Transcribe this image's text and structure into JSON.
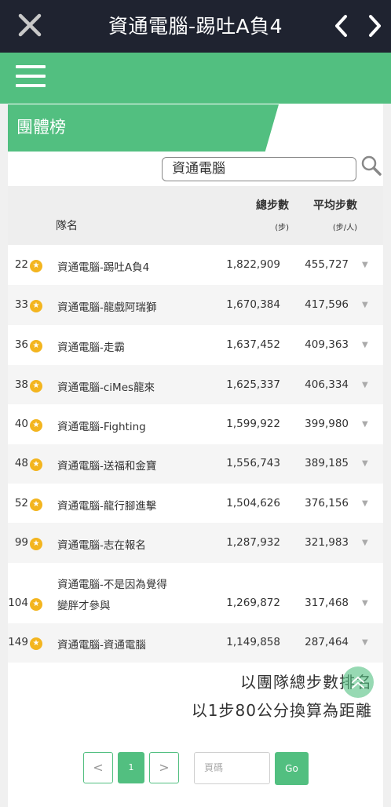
{
  "header": {
    "title": "資通電腦-踢吐A負4",
    "close_icon": "close-icon",
    "prev_icon": "chevron-left-icon",
    "next_icon": "chevron-right-icon"
  },
  "menu": {
    "icon": "hamburger-menu-icon"
  },
  "section": {
    "title": "團體榜"
  },
  "search": {
    "value": "資通電腦",
    "icon": "search-icon"
  },
  "table": {
    "headers": {
      "team": "隊名",
      "total": "總步數",
      "total_unit": "(步)",
      "avg": "平均步數",
      "avg_unit": "(步/人)"
    },
    "rows": [
      {
        "rank": "22",
        "name": "資通電腦-踢吐A負4",
        "total": "1,822,909",
        "avg": "455,727"
      },
      {
        "rank": "33",
        "name": "資通電腦-龍戲阿瑞獅",
        "total": "1,670,384",
        "avg": "417,596"
      },
      {
        "rank": "36",
        "name": "資通電腦-走霸",
        "total": "1,637,452",
        "avg": "409,363"
      },
      {
        "rank": "38",
        "name": "資通電腦-ciMes龍來",
        "total": "1,625,337",
        "avg": "406,334"
      },
      {
        "rank": "40",
        "name": "資通電腦-Fighting",
        "total": "1,599,922",
        "avg": "399,980"
      },
      {
        "rank": "48",
        "name": "資通電腦-送福和金寶",
        "total": "1,556,743",
        "avg": "389,185"
      },
      {
        "rank": "52",
        "name": "資通電腦-龍行腳進擊",
        "total": "1,504,626",
        "avg": "376,156"
      },
      {
        "rank": "99",
        "name": "資通電腦-志在報名",
        "total": "1,287,932",
        "avg": "321,983"
      },
      {
        "rank": "104",
        "name_line1": "資通電腦-不是因為覺得",
        "name_line2": "變胖才參與",
        "total": "1,269,872",
        "avg": "317,468"
      },
      {
        "rank": "149",
        "name": "資通電腦-資通電腦",
        "total": "1,149,858",
        "avg": "287,464"
      }
    ]
  },
  "notes": {
    "line1": "以團隊總步數排名",
    "line2": "以1步80公分換算為距離"
  },
  "pager": {
    "prev": "<",
    "current": "1",
    "next": ">",
    "input_placeholder": "頁碼",
    "go": "Go"
  },
  "colors": {
    "topbar": "#1f2330",
    "accent": "#52bf80",
    "star": "#f3b51f"
  }
}
